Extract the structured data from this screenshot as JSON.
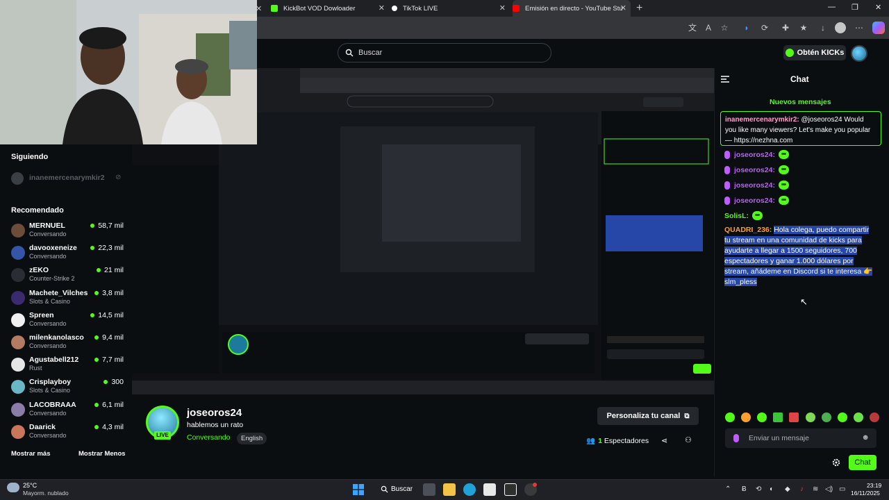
{
  "browser": {
    "tabs": [
      {
        "label": "KickBot VOD Dowloader",
        "color": "#53fc18"
      },
      {
        "label": "TikTok LIVE",
        "color": "#ffffff"
      },
      {
        "label": "Emisión en directo - YouTube Stu",
        "color": "#ff0000"
      }
    ]
  },
  "header": {
    "search_placeholder": "Buscar",
    "kicks_label": "Obtén KICKs"
  },
  "sidebar": {
    "following_heading": "Siguiendo",
    "following": [
      {
        "name": "inanemercenarymkir2"
      }
    ],
    "recommended_heading": "Recomendado",
    "channels": [
      {
        "name": "MERNUEL",
        "category": "Conversando",
        "viewers": "58,7 mil",
        "avatar_color": "#6b4d3a"
      },
      {
        "name": "davooxeneize",
        "category": "Conversando",
        "viewers": "22,3 mil",
        "avatar_color": "#3556a8"
      },
      {
        "name": "zEKO",
        "category": "Counter-Strike 2",
        "viewers": "21 mil",
        "avatar_color": "#2a2d33"
      },
      {
        "name": "Machete_Vilches",
        "category": "Slots & Casino",
        "viewers": "3,8 mil",
        "avatar_color": "#3b2a6e"
      },
      {
        "name": "Spreen",
        "category": "Conversando",
        "viewers": "14,5 mil",
        "avatar_color": "#f0f0f0"
      },
      {
        "name": "milenkanolasco",
        "category": "Conversando",
        "viewers": "9,4 mil",
        "avatar_color": "#b27b62"
      },
      {
        "name": "Agustabell212",
        "category": "Rust",
        "viewers": "7,7 mil",
        "avatar_color": "#e6e6e6"
      },
      {
        "name": "Crisplayboy",
        "category": "Slots & Casino",
        "viewers": "300",
        "avatar_color": "#69b6c7"
      },
      {
        "name": "LACOBRAAA",
        "category": "Conversando",
        "viewers": "6,1 mil",
        "avatar_color": "#8c7da8"
      },
      {
        "name": "Daarick",
        "category": "Conversando",
        "viewers": "4,3 mil",
        "avatar_color": "#c9765a"
      }
    ],
    "show_more": "Mostrar más",
    "show_less": "Mostrar Menos"
  },
  "stream": {
    "streamer": "joseoros24",
    "title": "hablemos un rato",
    "category": "Conversando",
    "language": "English",
    "live_badge": "LIVE",
    "customize_label": "Personaliza tu canal",
    "viewer_count": "1",
    "viewer_label": "Espectadores"
  },
  "chat": {
    "title": "Chat",
    "new_messages": "Nuevos mensajes",
    "pinned": {
      "user": "inanemercenarymkir2:",
      "text": "@joseoros24 Would you like many viewers? Let's make you popular — https://nezhna.com"
    },
    "emote_messages": [
      {
        "user": "joseoros24:",
        "color": "#c05bff"
      },
      {
        "user": "joseoros24:",
        "color": "#c05bff"
      },
      {
        "user": "joseoros24:",
        "color": "#c05bff"
      },
      {
        "user": "joseoros24:",
        "color": "#c05bff"
      },
      {
        "user": "SolisL:",
        "color": "#53fc18"
      }
    ],
    "spam": {
      "user": "QUADRI_236:",
      "text": "Hola colega, puedo compartir tu stream en una comunidad de kicks para ayudarte a llegar a 1500 seguidores, 700 espectadores y ganar 1.000 dólares por stream, añádeme en Discord si te interesa 👉 slm_pless"
    },
    "input_placeholder": "Enviar un mensaje",
    "send_label": "Chat"
  },
  "taskbar": {
    "weather_temp": "25°C",
    "weather_desc": "Mayorm. nublado",
    "search_label": "Buscar",
    "time": "23:19",
    "date": "16/11/2025"
  },
  "colors": {
    "accent": "#53fc18",
    "background": "#0b0e11",
    "highlight": "#2647a8"
  }
}
